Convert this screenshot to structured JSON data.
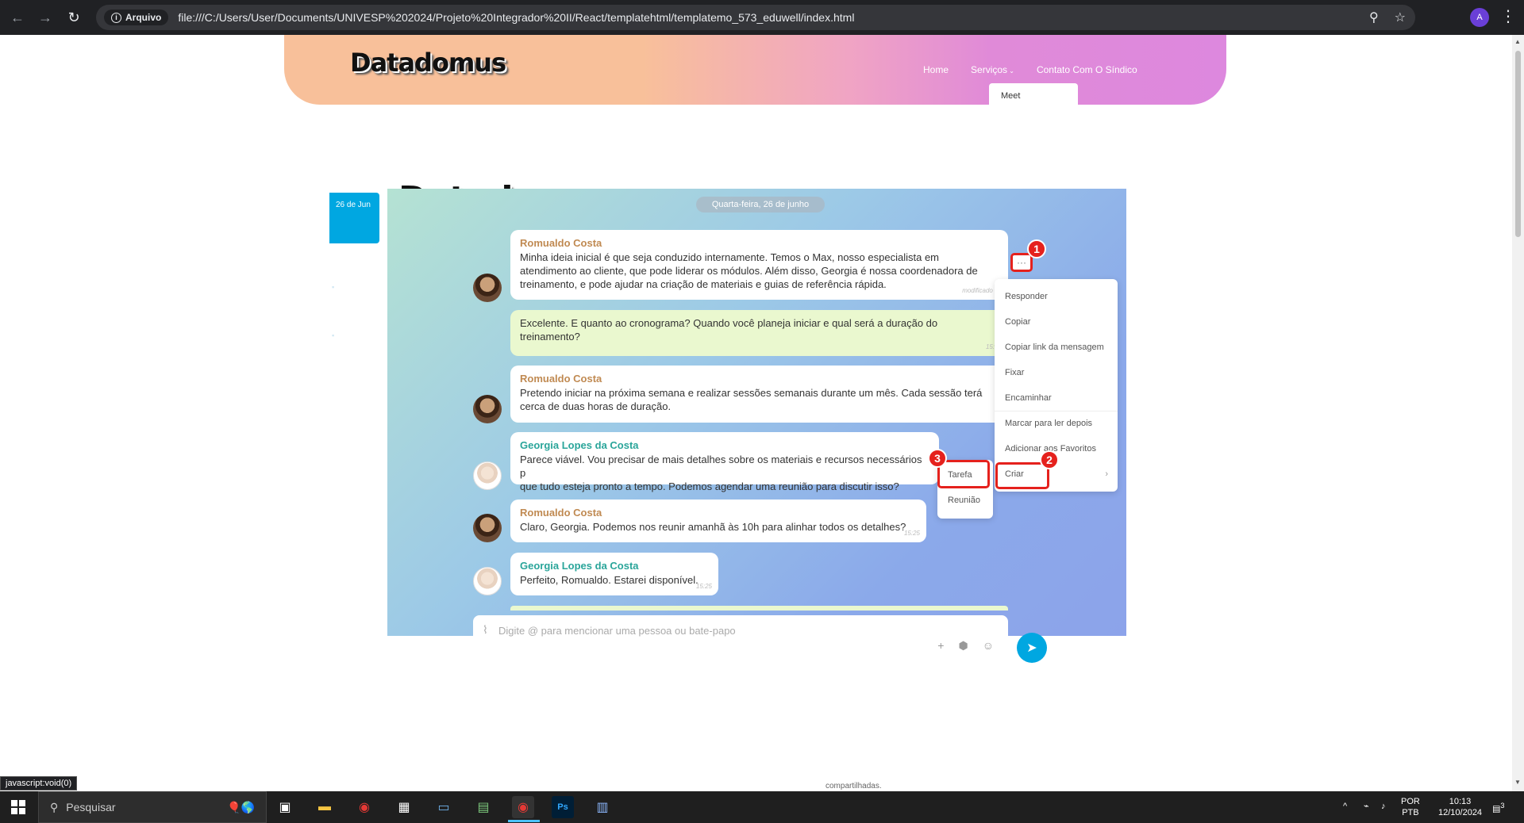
{
  "browser": {
    "security_chip": "Arquivo",
    "url": "file:///C:/Users/User/Documents/UNIVESP%202024/Projeto%20Integrador%20II/React/templatehtml/templatemo_573_eduwell/index.html",
    "profile_initial": "A"
  },
  "site": {
    "logo": "Datadomus",
    "nav": [
      "Home",
      "Serviços",
      "Contato Com O Síndico"
    ],
    "dropdown_item": "Meet",
    "content_logo": "Datadomus"
  },
  "chat": {
    "left_date": "26 de Jun",
    "date_pill": "Quarta-feira, 26 de junho",
    "messages": [
      {
        "author": "Romualdo Costa",
        "text": "Minha ideia inicial é que seja conduzido internamente. Temos o Max, nosso especialista em atendimento ao cliente, que pode liderar os módulos. Além disso, Georgia é nossa coordenadora de treinamento, e pode ajudar na criação de materiais e guias de referência rápida.",
        "time": "modificado 15"
      },
      {
        "author": "",
        "text": "Excelente. E quanto ao cronograma? Quando você planeja iniciar e qual será a duração do treinamento?",
        "time": "15:23"
      },
      {
        "author": "Romualdo Costa",
        "text": "Pretendo iniciar na próxima semana e realizar sessões semanais durante um mês. Cada sessão terá cerca de duas horas de duração.",
        "time": "15"
      },
      {
        "author": "Georgia Lopes da Costa",
        "text": "Parece viável. Vou precisar de mais detalhes sobre os materiais e recursos necessários p",
        "text2": "que tudo esteja pronto a tempo. Podemos agendar uma reunião para discutir isso?",
        "time": ""
      },
      {
        "author": "Romualdo Costa",
        "text": "Claro, Georgia. Podemos nos reunir amanhã às 10h para alinhar todos os detalhes?",
        "time": "15:25"
      },
      {
        "author": "Georgia Lopes da Costa",
        "text": "Perfeito, Romualdo. Estarei disponível.",
        "time": "15:25"
      }
    ],
    "context_menu": [
      "Responder",
      "Copiar",
      "Copiar link da mensagem",
      "Fixar",
      "Encaminhar",
      "Marcar para ler depois",
      "Adicionar aos Favoritos",
      "Criar"
    ],
    "submenu": [
      "Tarefa",
      "Reunião"
    ],
    "badges": [
      "1",
      "2",
      "3"
    ],
    "composer_placeholder": "Digite @ para mencionar uma pessoa ou bate-papo"
  },
  "page_footer_text": "compartilhadas.",
  "status_bar": "javascript:void(0)",
  "taskbar": {
    "search_label": "Pesquisar",
    "lang": "POR",
    "layout": "PTB",
    "time": "10:13",
    "date": "12/10/2024",
    "notif_count": "3"
  },
  "colors": {
    "accent": "#00a7e1",
    "highlight": "#e5211d"
  }
}
